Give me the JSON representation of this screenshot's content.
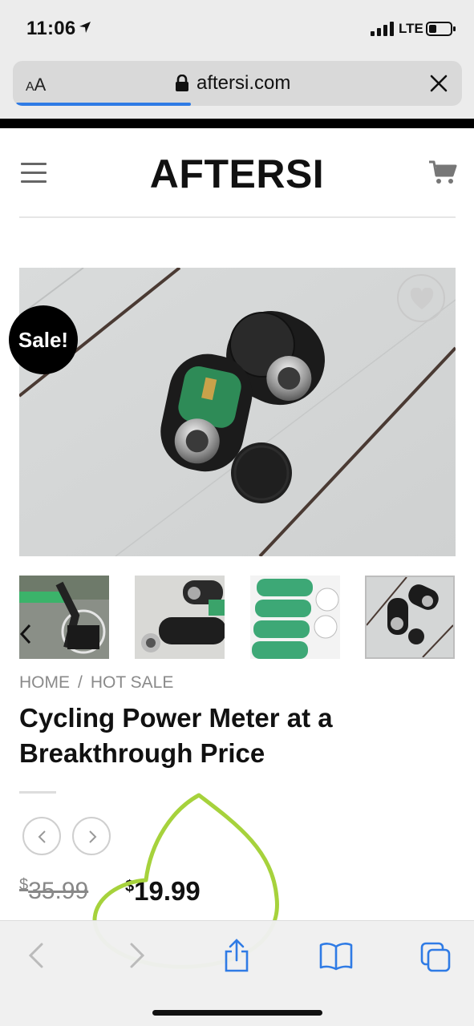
{
  "status_bar": {
    "time": "11:06",
    "location_icon": "location-arrow-icon",
    "signal_icon": "cellular-signal-icon",
    "network": "LTE",
    "battery_icon": "battery-low-icon"
  },
  "browser": {
    "text_size_label_small": "A",
    "text_size_label_large": "A",
    "lock_icon": "lock-icon",
    "domain": "aftersi.com",
    "close_icon": "close-icon",
    "load_progress": 0.39
  },
  "site": {
    "menu_icon": "hamburger-menu-icon",
    "logo": "AFTERSI",
    "cart_icon": "cart-icon"
  },
  "product": {
    "sale_badge": "Sale!",
    "wishlist_icon": "heart-icon",
    "thumbnails": [
      {
        "name": "thumbnail-indoor-trainer"
      },
      {
        "name": "thumbnail-power-meter-parts"
      },
      {
        "name": "thumbnail-circuit-boards"
      },
      {
        "name": "thumbnail-power-meter-pods"
      }
    ],
    "active_thumbnail_index": 3,
    "breadcrumb": {
      "home": "HOME",
      "separator": "/",
      "category": "HOT SALE"
    },
    "title": "Cycling Power Meter at a Breakthrough Price",
    "currency_symbol": "$",
    "original_price": "35.99",
    "sale_price": "19.99"
  },
  "toolbar": {
    "back_icon": "chevron-left-icon",
    "forward_icon": "chevron-right-icon",
    "share_icon": "share-icon",
    "bookmarks_icon": "book-icon",
    "tabs_icon": "tabs-icon"
  },
  "colors": {
    "accent_blue": "#2f7be5",
    "annotation_green": "#a6d23c",
    "sale_badge_bg": "#000000"
  }
}
